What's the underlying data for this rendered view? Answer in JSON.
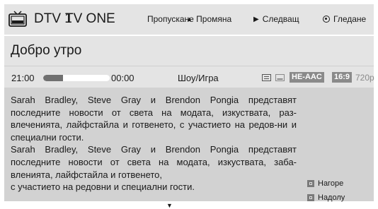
{
  "header": {
    "channel_number": "DTV 1",
    "channel_name": "TV ONE",
    "skip_label": "Пропускане Промяна",
    "next_label": "Следващ",
    "watch_label": "Гледане"
  },
  "program": {
    "title": "Добро утро",
    "start_time": "21:00",
    "end_time": "00:00",
    "progress": 0.3,
    "genre": "Шоу/Игра",
    "audio_badge": "HE-AAC",
    "aspect_badge": "16:9",
    "resolution": "720p"
  },
  "description": {
    "paragraphs": [
      "Sarah Bradley, Steve Gray и Brendon Pongia представят последните новости от света на модата, изкуствата, раз-влеченията, лайфстайла и готвенето, с участието на редов-ни и специални гости.",
      "Sarah Bradley, Steve Gray и Brendon Pongia представят последните новости от света на модата, изкуствата, заба-вленията, лайфстайла и готвенето,",
      "с участието на редовни и специални гости."
    ],
    "scroll_up_label": "Нагоре",
    "scroll_down_label": "Надолу"
  },
  "colors": {
    "panel": "#e4e4e4",
    "description_bg": "#d2d2d2",
    "badge": "#8a8a8a"
  },
  "icons": [
    "tv-icon",
    "play-icon",
    "radio-icon",
    "list-icon",
    "subtitle-icon",
    "key-icon",
    "scroll-down-arrow-icon"
  ]
}
